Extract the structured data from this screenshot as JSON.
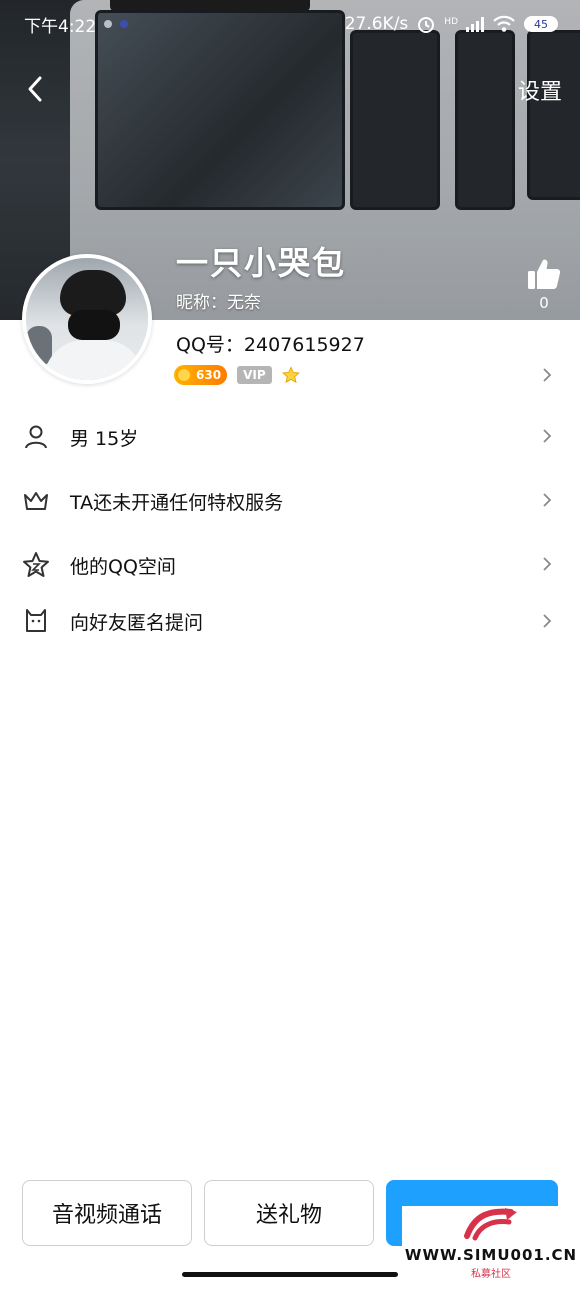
{
  "status_bar": {
    "time": "下午4:22",
    "net_speed": "27.6K/s",
    "hd": "HD",
    "battery": "45"
  },
  "nav": {
    "settings_label": "设置"
  },
  "profile": {
    "display_name": "一只小哭包",
    "nickname": "昵称：无奈",
    "qq_number": "QQ号：2407615927",
    "likes": "0",
    "level_badge": "630",
    "vip_badge": "VIP"
  },
  "list": {
    "items": [
      {
        "icon": "person-icon",
        "label": "男   15岁"
      },
      {
        "icon": "crown-icon",
        "label": "TA还未开通任何特权服务"
      },
      {
        "icon": "star-icon",
        "label": "他的QQ空间"
      },
      {
        "icon": "cat-icon",
        "label": "向好友匿名提问"
      }
    ]
  },
  "bottom_bar": {
    "call_label": "音视频通话",
    "gift_label": "送礼物"
  },
  "watermark": {
    "site": "WWW.SIMU001.CN",
    "sub": "私募社区"
  },
  "colors": {
    "primary": "#1ea0ff",
    "level_badge": "#ff9a00",
    "vip_badge": "#b5b5b5",
    "watermark_red": "#d8324a"
  }
}
